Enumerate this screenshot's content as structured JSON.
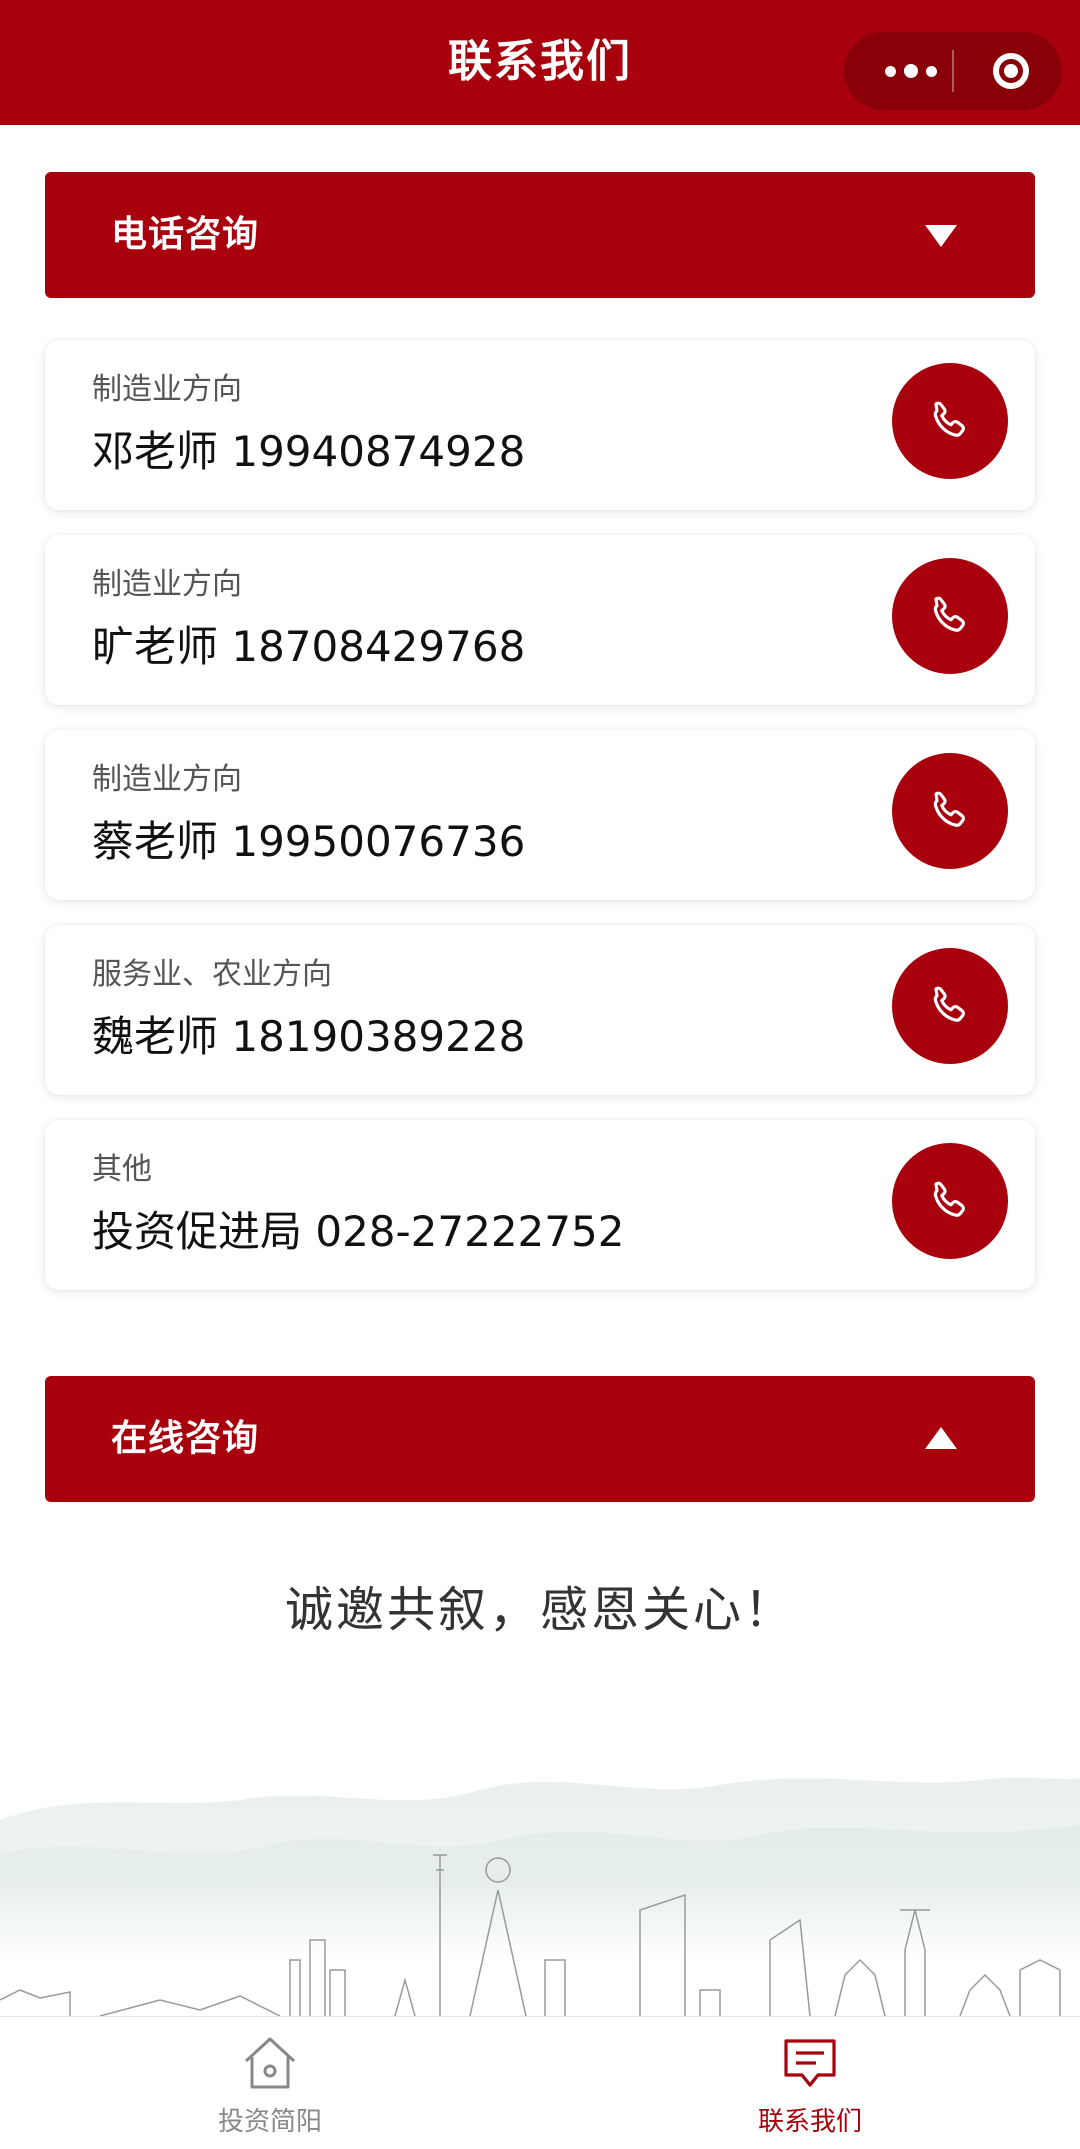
{
  "header": {
    "title": "联系我们"
  },
  "colors": {
    "primary": "#a8000c",
    "tab_inactive": "#888888"
  },
  "phone_section": {
    "label": "电话咨询",
    "arrow_icon": "triangle-down-icon"
  },
  "contacts": [
    {
      "direction": "制造业方向",
      "name": "邓老师 19940874928"
    },
    {
      "direction": "制造业方向",
      "name": "旷老师 18708429768"
    },
    {
      "direction": "制造业方向",
      "name": "蔡老师 19950076736"
    },
    {
      "direction": "服务业、农业方向",
      "name": "魏老师 18190389228"
    },
    {
      "direction": "其他",
      "name": "投资促进局 028-27222752"
    }
  ],
  "online_section": {
    "label": "在线咨询",
    "arrow_icon": "triangle-up-icon"
  },
  "invite_text": "诚邀共叙，感恩关心！",
  "tabbar": {
    "tabs": [
      {
        "label": "投资简阳",
        "icon": "home-icon",
        "active": false
      },
      {
        "label": "联系我们",
        "icon": "message-icon",
        "active": true
      }
    ]
  }
}
